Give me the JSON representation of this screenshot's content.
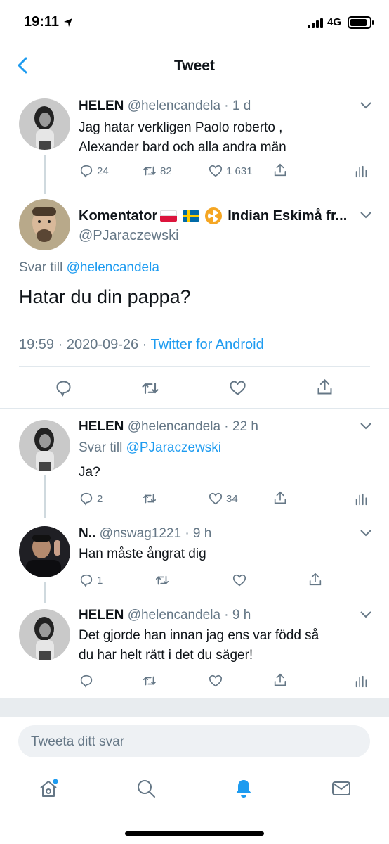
{
  "status_bar": {
    "time": "19:11",
    "network": "4G"
  },
  "header": {
    "title": "Tweet"
  },
  "tweets": [
    {
      "display_name": "HELEN",
      "handle_time": "@helencandela · 1 d",
      "text_lines": [
        "Jag hatar verkligen Paolo roberto ,",
        "Alexander bard och alla andra män"
      ],
      "replies": "24",
      "retweets": "82",
      "likes": "1 631"
    },
    {
      "reply_count": "2",
      "like_count": "34"
    },
    {
      "reply_count": "1"
    }
  ],
  "main_tweet": {
    "display_name": "Komentator",
    "display_name_suffix": "Indian Eskimå fr...",
    "handle": "@PJaraczewski",
    "reply_to_prefix": "Svar till ",
    "reply_to_handle": "@helencandela",
    "text": "Hatar du din pappa?",
    "timestamp": "19:59 · 2020-09-26 · ",
    "source": "Twitter for Android"
  },
  "reply1": {
    "display_name": "HELEN",
    "handle_time": "@helencandela · 22 h",
    "reply_to_prefix": "Svar till ",
    "reply_to_handle": "@PJaraczewski",
    "text": "Ja?",
    "replies": "2",
    "likes": "34"
  },
  "reply2": {
    "display_name": "N..",
    "handle_time": "@nswag1221 · 9 h",
    "text": "Han måste ångrat dig",
    "replies": "1"
  },
  "reply3": {
    "display_name": "HELEN",
    "handle_time": "@helencandela · 9 h",
    "text_lines": [
      "Det gjorde han innan jag ens var född så",
      "du har helt rätt i det du säger!"
    ]
  },
  "composer": {
    "placeholder": "Tweeta ditt svar"
  },
  "icons": [
    "location-arrow-icon",
    "back-chevron-icon",
    "reply-icon",
    "retweet-icon",
    "like-icon",
    "share-icon",
    "analytics-icon",
    "home-icon",
    "search-icon",
    "notifications-icon",
    "messages-icon"
  ],
  "colors": {
    "accent": "#1d9bf0",
    "secondary_text": "#657786",
    "divider": "#e1e8ed"
  }
}
